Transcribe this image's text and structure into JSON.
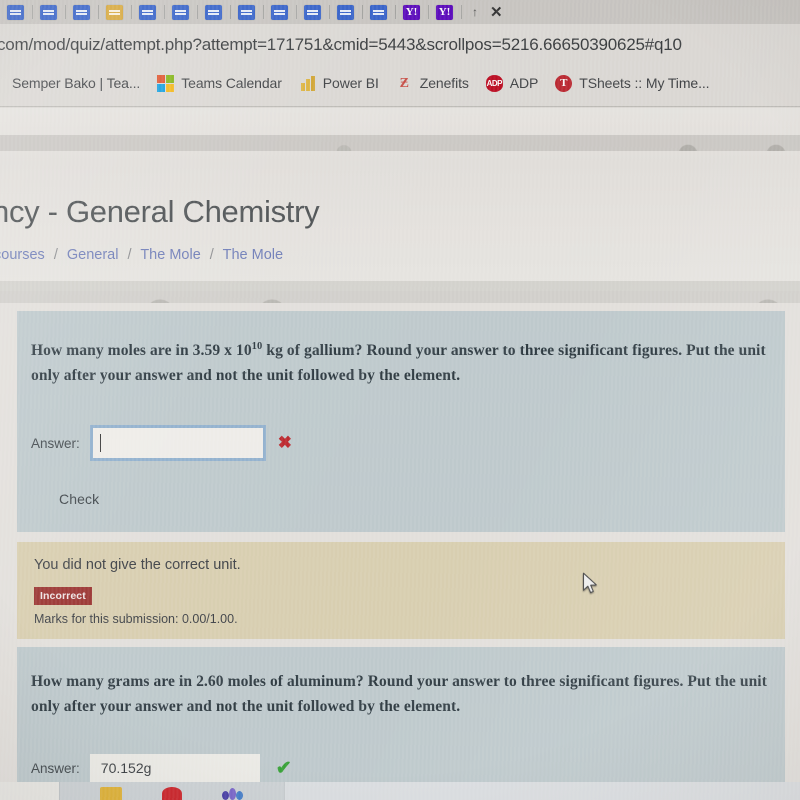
{
  "browser": {
    "tabs": [
      {
        "favicon": "doc-blue-icon"
      },
      {
        "favicon": "doc-blue-icon"
      },
      {
        "favicon": "doc-blue-icon"
      },
      {
        "favicon": "doc-gold-icon"
      },
      {
        "favicon": "doc-blue-icon"
      },
      {
        "favicon": "doc-blue-icon"
      },
      {
        "favicon": "doc-blue-icon"
      },
      {
        "favicon": "doc-blue-icon"
      },
      {
        "favicon": "doc-blue-icon"
      },
      {
        "favicon": "doc-blue-icon"
      },
      {
        "favicon": "doc-blue-icon"
      },
      {
        "favicon": "doc-blue-icon"
      },
      {
        "favicon": "yahoo-icon",
        "label": "Y!"
      },
      {
        "favicon": "yahoo-icon",
        "label": "Y!"
      }
    ],
    "close_label": "✕",
    "newtab_label": "↑",
    "url": "com/mod/quiz/attempt.php?attempt=171751&cmid=5443&scrollpos=5216.66650390625#q10",
    "bookmarks": [
      {
        "label": "Semper Bako | Tea...",
        "icon": "none"
      },
      {
        "label": "Teams Calendar",
        "icon": "microsoft-icon"
      },
      {
        "label": "Power BI",
        "icon": "powerbi-icon"
      },
      {
        "label": "Zenefits",
        "icon": "zenefits-icon",
        "glyph": "Ƶ"
      },
      {
        "label": "ADP",
        "icon": "adp-icon",
        "glyph": "ADP"
      },
      {
        "label": "TSheets :: My Time...",
        "icon": "tsheets-icon",
        "glyph": "T"
      }
    ]
  },
  "page": {
    "course_title": "ncy - General Chemistry",
    "breadcrumb": {
      "items": [
        "courses",
        "General",
        "The Mole",
        "The Mole"
      ],
      "separator": "/"
    }
  },
  "colors": {
    "question_bg": "#bfccd0",
    "feedback_bg": "#ddd1ae",
    "incorrect_badge": "#a8322f",
    "correct_check": "#2aa82a",
    "incorrect_mark": "#cf2027",
    "input_border_focus": "#8fb4d6",
    "breadcrumb_link": "#6d7ec2"
  },
  "questions": [
    {
      "text_part1": "How many moles are in 3.59 x 10",
      "exponent": "10",
      "text_part2": " kg of gallium?  Round your answer to three significant figures.  Put the unit only after your answer and not the unit followed by the element.",
      "answer_label": "Answer:",
      "answer_value": "",
      "answer_placeholder": "",
      "mark": "✖",
      "mark_meaning": "incorrect",
      "check_button": "Check",
      "feedback": {
        "message": "You did not give the correct unit.",
        "badge": "Incorrect",
        "marks": "Marks for this submission: 0.00/1.00."
      }
    },
    {
      "text_part1": "How many grams are in 2.60 moles of aluminum?  Round your answer to three significant figures.  Put the unit only after your answer and not the unit followed by the element.",
      "exponent": "",
      "text_part2": "",
      "answer_label": "Answer:",
      "answer_value": "70.152g",
      "mark": "✔",
      "mark_meaning": "correct"
    }
  ],
  "taskbar": {
    "items": [
      "start-button",
      "folder-icon",
      "red-app-icon",
      "multicolor-app-icon"
    ]
  }
}
